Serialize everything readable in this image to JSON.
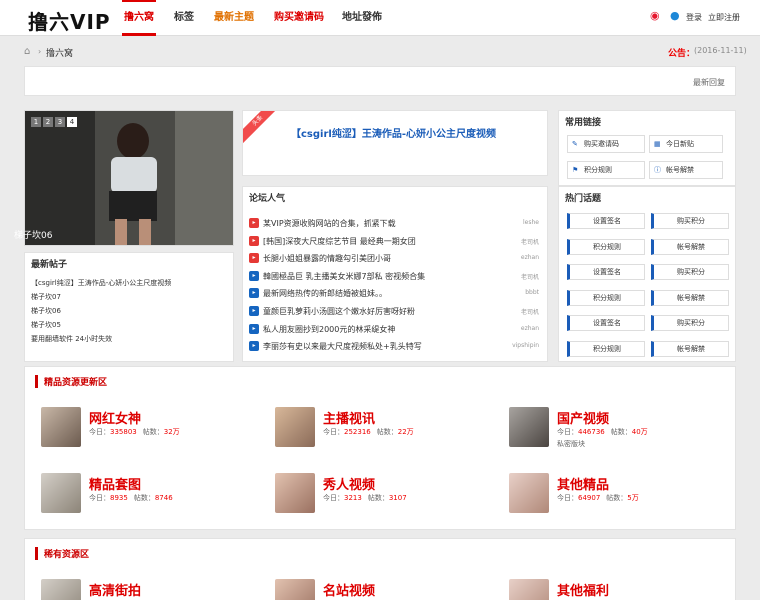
{
  "header": {
    "logo": "撸六VIP",
    "nav": [
      "撸六窝",
      "标签",
      "最新主题",
      "购买邀请码",
      "地址發佈"
    ],
    "login": "登录",
    "register": "立即注册"
  },
  "breadcrumb": {
    "current": "撸六窝"
  },
  "notice": {
    "label": "公告：",
    "date": "(2016-11-11)"
  },
  "latest_reply_label": "最新回复",
  "slideshow": {
    "dots": [
      "1",
      "2",
      "3",
      "4"
    ],
    "caption": "梯子坎06"
  },
  "latest_posts": {
    "title": "最新帖子",
    "items": [
      "【csgirl纯涩】王涛作品-心妍小公主尺度视频",
      "梯子坎07",
      "梯子坎06",
      "梯子坎05",
      "要用翻墙软件 24小时失效"
    ]
  },
  "featured": {
    "ribbon": "头条",
    "title": "【csgirl纯涩】王涛作品-心妍小公主尺度视频"
  },
  "hot_forum": {
    "title": "论坛人气",
    "items": [
      {
        "title": "某VIP资源收购网站的合集，抓紧下载",
        "author": "leshe",
        "color": "#e53935"
      },
      {
        "title": "[韩国]深夜大尺度综艺节目 最经典一期女团",
        "author": "老司机",
        "color": "#e53935"
      },
      {
        "title": "长腿小姐姐暴露的情趣勾引美团小哥",
        "author": "ezhan",
        "color": "#e53935"
      },
      {
        "title": "韓國極品巨 乳主播美女米娜7部私 密视频合集",
        "author": "老司机",
        "color": "#1565c0"
      },
      {
        "title": "最新网络热传的新郎结婚被姐妹。。",
        "author": "bbbt",
        "color": "#1565c0"
      },
      {
        "title": "童颜巨乳萝莉小汤圆这个嫩水好厉害呀好粉",
        "author": "老司机",
        "color": "#1565c0"
      },
      {
        "title": "私人朋友圈抄到2000元的林采缇女神",
        "author": "ezhan",
        "color": "#1565c0"
      },
      {
        "title": "李丽莎有史以来最大尺度视频私处+乳头特写",
        "author": "vipshipin",
        "color": "#1565c0"
      }
    ]
  },
  "common_links": {
    "title": "常用链接",
    "items": [
      "购买邀请码",
      "今日新贴",
      "积分规则",
      "帐号解禁"
    ]
  },
  "hot_topics": {
    "title": "热门话题",
    "items": [
      "设置签名",
      "购买积分",
      "积分规则",
      "帐号解禁",
      "设置签名",
      "购买积分",
      "积分规则",
      "帐号解禁",
      "设置签名",
      "购买积分",
      "积分规则",
      "帐号解禁"
    ]
  },
  "sections": [
    {
      "title": "精品资源更新区",
      "forums": [
        {
          "name": "网红女神",
          "today_label": "今日：",
          "today": "335803",
          "posts_label": "帖数：",
          "posts": "32万",
          "extra": ""
        },
        {
          "name": "主播视讯",
          "today_label": "今日：",
          "today": "252316",
          "posts_label": "帖数：",
          "posts": "22万",
          "extra": ""
        },
        {
          "name": "国产视频",
          "today_label": "今日：",
          "today": "446736",
          "posts_label": "帖数：",
          "posts": "40万",
          "extra": "私密版块"
        },
        {
          "name": "精品套图",
          "today_label": "今日：",
          "today": "8935",
          "posts_label": "帖数：",
          "posts": "8746",
          "extra": ""
        },
        {
          "name": "秀人视频",
          "today_label": "今日：",
          "today": "3213",
          "posts_label": "帖数：",
          "posts": "3107",
          "extra": ""
        },
        {
          "name": "其他精品",
          "today_label": "今日：",
          "today": "64907",
          "posts_label": "帖数：",
          "posts": "5万",
          "extra": ""
        }
      ]
    },
    {
      "title": "稀有资源区",
      "forums": [
        {
          "name": "高清街拍"
        },
        {
          "name": "名站视频"
        },
        {
          "name": "其他福利"
        }
      ]
    }
  ],
  "colors": {
    "accent": "#dd0000",
    "link": "#1a5cb8",
    "background": "#ebebeb"
  }
}
